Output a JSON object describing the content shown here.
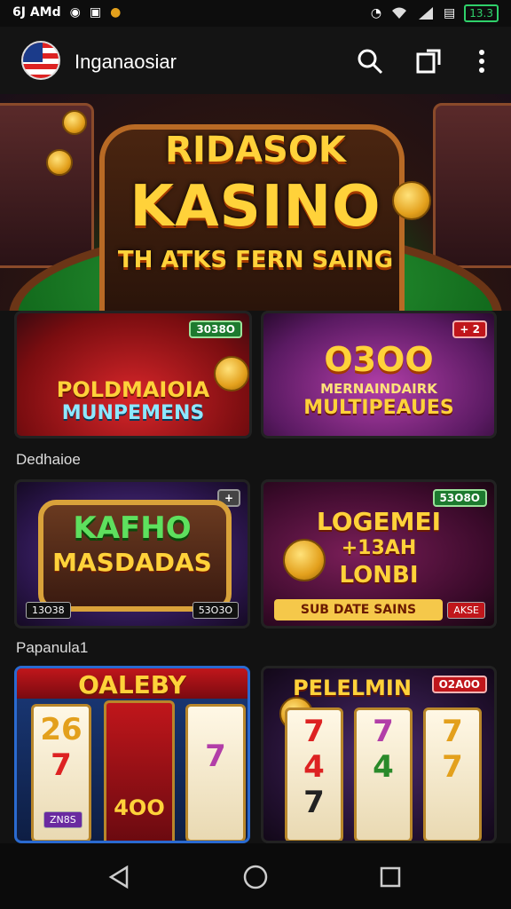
{
  "status_bar": {
    "left_text": "6J AMd",
    "battery": "13.3"
  },
  "app_bar": {
    "title": "Inganaosiar"
  },
  "hero": {
    "line1": "RIDASOK",
    "line2": "KASINO",
    "line3": "TH ATKS FERN SAING"
  },
  "tiles_row1": [
    {
      "title_top": "POLDMAIOIA",
      "title_bottom": "MUNPEMENS",
      "badge": "3038O"
    },
    {
      "title_top": "O3OO",
      "title_mid": "MERNAINDAIRK",
      "title_bottom": "MULTIPEAUES",
      "badge": "+ 2"
    }
  ],
  "section1_label": "Dedhaioe",
  "tiles_row2": [
    {
      "title_top": "KAFHO",
      "title_bottom": "MASDADAS",
      "tag_left": "13O38",
      "tag_right": "53O3O",
      "badge": "+"
    },
    {
      "title_top": "LOGEMEI",
      "title_mid": "+13AH",
      "title_bottom": "LONBI",
      "strip": "SUB DATE SAINS",
      "tag_right": "AKSE",
      "badge": "53O8O"
    }
  ],
  "section2_label": "Papanula1",
  "tiles_row3": [
    {
      "title": "OALEBY",
      "reel_values": [
        "26",
        "7",
        "7"
      ],
      "center_value": "4OO",
      "bottom_tag": "ZN8S"
    },
    {
      "title": "PELELMIN",
      "badge": "O2A0O",
      "reel_values": [
        "7",
        "7",
        "7",
        "4",
        "4",
        "7",
        "7"
      ]
    }
  ],
  "colors": {
    "accent_gold": "#ffd23a",
    "badge_green": "#1d7a2f",
    "badge_red": "#c0161b"
  },
  "icons": [
    "search-icon",
    "cast-icon",
    "more-vert-icon",
    "back-icon",
    "home-icon",
    "recents-icon"
  ]
}
